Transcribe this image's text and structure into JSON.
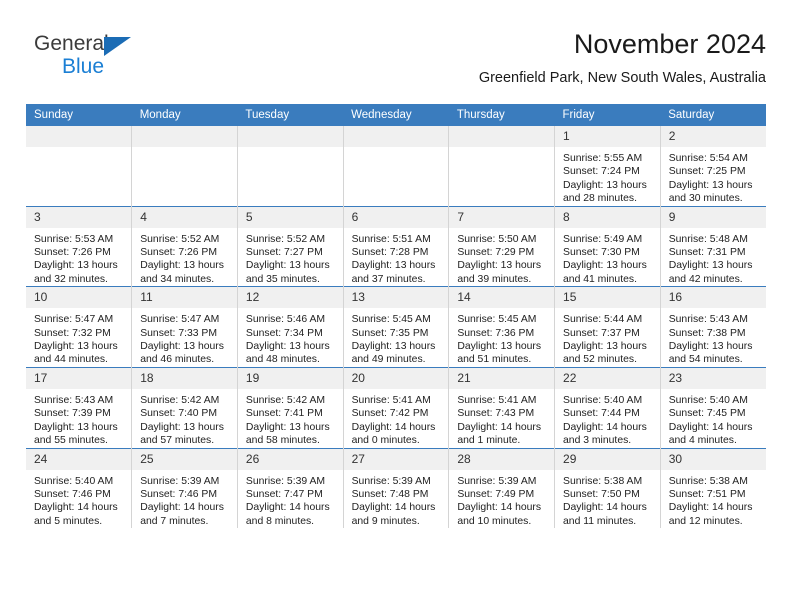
{
  "brand": {
    "name_part1": "General",
    "name_part2": "Blue",
    "triangle_color": "#1b6cb5",
    "blue_color": "#1b7fd4"
  },
  "header": {
    "title": "November 2024",
    "subtitle": "Greenfield Park, New South Wales, Australia"
  },
  "theme": {
    "header_row_bg": "#3a7cbe",
    "daynum_bg": "#f0f0f0",
    "cell_border": "#d4d4d4",
    "row_top_border": "#3a7cbe"
  },
  "weekday_headers": [
    "Sunday",
    "Monday",
    "Tuesday",
    "Wednesday",
    "Thursday",
    "Friday",
    "Saturday"
  ],
  "weeks": [
    [
      {
        "day": "",
        "blank": true
      },
      {
        "day": "",
        "blank": true
      },
      {
        "day": "",
        "blank": true
      },
      {
        "day": "",
        "blank": true
      },
      {
        "day": "",
        "blank": true
      },
      {
        "day": "1",
        "sunrise": "Sunrise: 5:55 AM",
        "sunset": "Sunset: 7:24 PM",
        "daylight": "Daylight: 13 hours and 28 minutes."
      },
      {
        "day": "2",
        "sunrise": "Sunrise: 5:54 AM",
        "sunset": "Sunset: 7:25 PM",
        "daylight": "Daylight: 13 hours and 30 minutes."
      }
    ],
    [
      {
        "day": "3",
        "sunrise": "Sunrise: 5:53 AM",
        "sunset": "Sunset: 7:26 PM",
        "daylight": "Daylight: 13 hours and 32 minutes."
      },
      {
        "day": "4",
        "sunrise": "Sunrise: 5:52 AM",
        "sunset": "Sunset: 7:26 PM",
        "daylight": "Daylight: 13 hours and 34 minutes."
      },
      {
        "day": "5",
        "sunrise": "Sunrise: 5:52 AM",
        "sunset": "Sunset: 7:27 PM",
        "daylight": "Daylight: 13 hours and 35 minutes."
      },
      {
        "day": "6",
        "sunrise": "Sunrise: 5:51 AM",
        "sunset": "Sunset: 7:28 PM",
        "daylight": "Daylight: 13 hours and 37 minutes."
      },
      {
        "day": "7",
        "sunrise": "Sunrise: 5:50 AM",
        "sunset": "Sunset: 7:29 PM",
        "daylight": "Daylight: 13 hours and 39 minutes."
      },
      {
        "day": "8",
        "sunrise": "Sunrise: 5:49 AM",
        "sunset": "Sunset: 7:30 PM",
        "daylight": "Daylight: 13 hours and 41 minutes."
      },
      {
        "day": "9",
        "sunrise": "Sunrise: 5:48 AM",
        "sunset": "Sunset: 7:31 PM",
        "daylight": "Daylight: 13 hours and 42 minutes."
      }
    ],
    [
      {
        "day": "10",
        "sunrise": "Sunrise: 5:47 AM",
        "sunset": "Sunset: 7:32 PM",
        "daylight": "Daylight: 13 hours and 44 minutes."
      },
      {
        "day": "11",
        "sunrise": "Sunrise: 5:47 AM",
        "sunset": "Sunset: 7:33 PM",
        "daylight": "Daylight: 13 hours and 46 minutes."
      },
      {
        "day": "12",
        "sunrise": "Sunrise: 5:46 AM",
        "sunset": "Sunset: 7:34 PM",
        "daylight": "Daylight: 13 hours and 48 minutes."
      },
      {
        "day": "13",
        "sunrise": "Sunrise: 5:45 AM",
        "sunset": "Sunset: 7:35 PM",
        "daylight": "Daylight: 13 hours and 49 minutes."
      },
      {
        "day": "14",
        "sunrise": "Sunrise: 5:45 AM",
        "sunset": "Sunset: 7:36 PM",
        "daylight": "Daylight: 13 hours and 51 minutes."
      },
      {
        "day": "15",
        "sunrise": "Sunrise: 5:44 AM",
        "sunset": "Sunset: 7:37 PM",
        "daylight": "Daylight: 13 hours and 52 minutes."
      },
      {
        "day": "16",
        "sunrise": "Sunrise: 5:43 AM",
        "sunset": "Sunset: 7:38 PM",
        "daylight": "Daylight: 13 hours and 54 minutes."
      }
    ],
    [
      {
        "day": "17",
        "sunrise": "Sunrise: 5:43 AM",
        "sunset": "Sunset: 7:39 PM",
        "daylight": "Daylight: 13 hours and 55 minutes."
      },
      {
        "day": "18",
        "sunrise": "Sunrise: 5:42 AM",
        "sunset": "Sunset: 7:40 PM",
        "daylight": "Daylight: 13 hours and 57 minutes."
      },
      {
        "day": "19",
        "sunrise": "Sunrise: 5:42 AM",
        "sunset": "Sunset: 7:41 PM",
        "daylight": "Daylight: 13 hours and 58 minutes."
      },
      {
        "day": "20",
        "sunrise": "Sunrise: 5:41 AM",
        "sunset": "Sunset: 7:42 PM",
        "daylight": "Daylight: 14 hours and 0 minutes."
      },
      {
        "day": "21",
        "sunrise": "Sunrise: 5:41 AM",
        "sunset": "Sunset: 7:43 PM",
        "daylight": "Daylight: 14 hours and 1 minute."
      },
      {
        "day": "22",
        "sunrise": "Sunrise: 5:40 AM",
        "sunset": "Sunset: 7:44 PM",
        "daylight": "Daylight: 14 hours and 3 minutes."
      },
      {
        "day": "23",
        "sunrise": "Sunrise: 5:40 AM",
        "sunset": "Sunset: 7:45 PM",
        "daylight": "Daylight: 14 hours and 4 minutes."
      }
    ],
    [
      {
        "day": "24",
        "sunrise": "Sunrise: 5:40 AM",
        "sunset": "Sunset: 7:46 PM",
        "daylight": "Daylight: 14 hours and 5 minutes."
      },
      {
        "day": "25",
        "sunrise": "Sunrise: 5:39 AM",
        "sunset": "Sunset: 7:46 PM",
        "daylight": "Daylight: 14 hours and 7 minutes."
      },
      {
        "day": "26",
        "sunrise": "Sunrise: 5:39 AM",
        "sunset": "Sunset: 7:47 PM",
        "daylight": "Daylight: 14 hours and 8 minutes."
      },
      {
        "day": "27",
        "sunrise": "Sunrise: 5:39 AM",
        "sunset": "Sunset: 7:48 PM",
        "daylight": "Daylight: 14 hours and 9 minutes."
      },
      {
        "day": "28",
        "sunrise": "Sunrise: 5:39 AM",
        "sunset": "Sunset: 7:49 PM",
        "daylight": "Daylight: 14 hours and 10 minutes."
      },
      {
        "day": "29",
        "sunrise": "Sunrise: 5:38 AM",
        "sunset": "Sunset: 7:50 PM",
        "daylight": "Daylight: 14 hours and 11 minutes."
      },
      {
        "day": "30",
        "sunrise": "Sunrise: 5:38 AM",
        "sunset": "Sunset: 7:51 PM",
        "daylight": "Daylight: 14 hours and 12 minutes."
      }
    ]
  ]
}
